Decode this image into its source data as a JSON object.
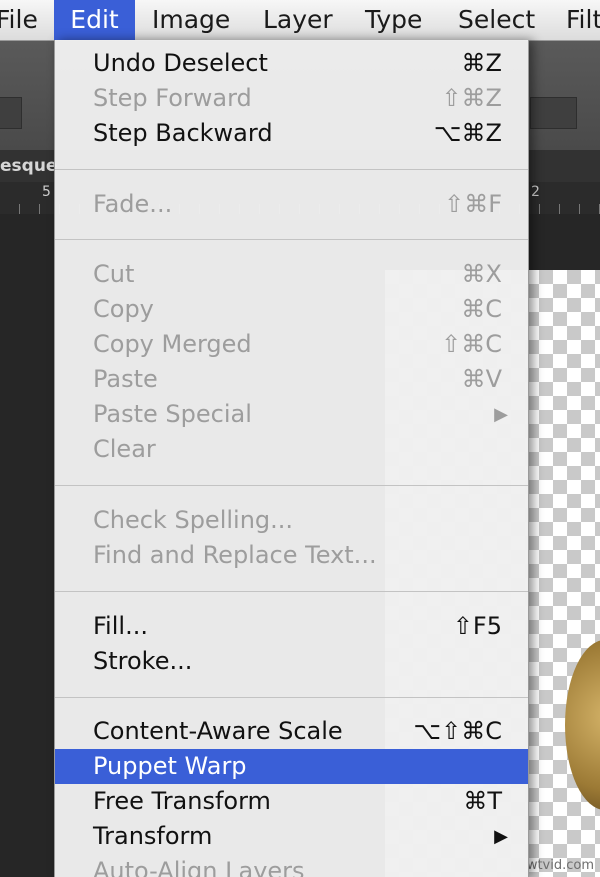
{
  "menubar": {
    "items": [
      "File",
      "Edit",
      "Image",
      "Layer",
      "Type",
      "Select",
      "Filt"
    ]
  },
  "document": {
    "tab_label": "esque"
  },
  "ruler": {
    "labels": [
      "5",
      "2"
    ]
  },
  "edit_menu": {
    "items": [
      {
        "label": "Undo Deselect",
        "shortcut": "⌘Z",
        "enabled": true
      },
      {
        "label": "Step Forward",
        "shortcut": "⇧⌘Z",
        "enabled": false
      },
      {
        "label": "Step Backward",
        "shortcut": "⌥⌘Z",
        "enabled": true
      },
      {
        "label": "Fade...",
        "shortcut": "⇧⌘F",
        "enabled": false
      },
      {
        "label": "Cut",
        "shortcut": "⌘X",
        "enabled": false
      },
      {
        "label": "Copy",
        "shortcut": "⌘C",
        "enabled": false
      },
      {
        "label": "Copy Merged",
        "shortcut": "⇧⌘C",
        "enabled": false
      },
      {
        "label": "Paste",
        "shortcut": "⌘V",
        "enabled": false
      },
      {
        "label": "Paste Special",
        "submenu": true,
        "enabled": false
      },
      {
        "label": "Clear",
        "enabled": false
      },
      {
        "label": "Check Spelling...",
        "enabled": false
      },
      {
        "label": "Find and Replace Text...",
        "enabled": false
      },
      {
        "label": "Fill...",
        "shortcut": "⇧F5",
        "enabled": true
      },
      {
        "label": "Stroke...",
        "enabled": true
      },
      {
        "label": "Content-Aware Scale",
        "shortcut": "⌥⇧⌘C",
        "enabled": true
      },
      {
        "label": "Puppet Warp",
        "enabled": true,
        "highlighted": true
      },
      {
        "label": "Free Transform",
        "shortcut": "⌘T",
        "enabled": true
      },
      {
        "label": "Transform",
        "submenu": true,
        "enabled": true
      },
      {
        "label": "Auto-Align Layers",
        "enabled": false
      }
    ]
  },
  "watermark": "wtvid.com",
  "colors": {
    "menu_highlight": "#3a5fd7",
    "disabled_text": "#9d9d9d",
    "menu_background": "#f0f0f0"
  }
}
